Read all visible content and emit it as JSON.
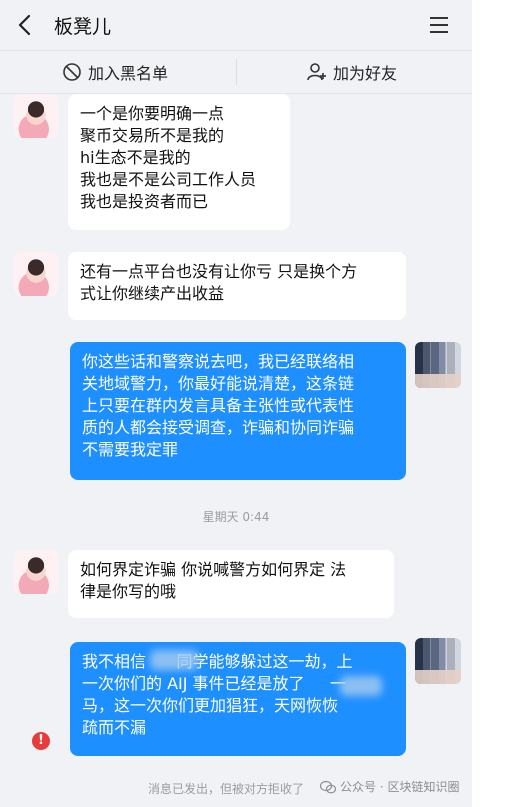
{
  "header": {
    "title": "板凳儿"
  },
  "actions": {
    "blacklist_label": "加入黑名单",
    "add_friend_label": "加为好友"
  },
  "messages": [
    {
      "text": "一个是你要明确一点\n聚币交易所不是我的\nhi生态不是我的\n我也是不是公司工作人员\n我也是投资者而已"
    },
    {
      "text": "还有一点平台也没有让你亏 只是换个方\n式让你继续产出收益"
    },
    {
      "text": "你这些话和警察说去吧，我已经联络相\n关地域警力，你最好能说清楚，这条链\n上只要在群内发言具备主张性或代表性\n质的人都会接受调查，诈骗和协同诈骗\n不需要我定罪"
    },
    {
      "text": "如何界定诈骗 你说喊警方如何界定 法\n律是你写的哦"
    },
    {
      "text": "我不相信      同学能够躲过这一劫，上\n一次你们的 AIJ 事件已经是放了     一\n马，这一次你们更加猖狂，天网恢恢\n疏而不漏"
    }
  ],
  "timestamp": "星期天 0:44",
  "footer": {
    "note": "消息已发出，但被对方拒收了",
    "watermark": "公众号 · 区块链知识圈"
  },
  "colors": {
    "outgoing_bubble": "#1e8fff",
    "background": "#f1f2f6",
    "error": "#e83b3b"
  }
}
